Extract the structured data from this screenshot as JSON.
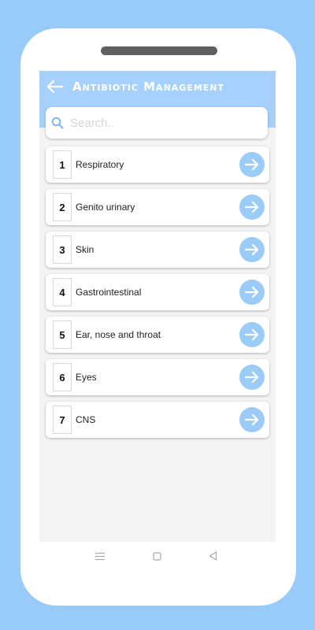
{
  "app": {
    "title": "Antibiotic Management"
  },
  "search": {
    "placeholder": "Search..",
    "value": ""
  },
  "items": [
    {
      "number": "1",
      "label": "Respiratory"
    },
    {
      "number": "2",
      "label": "Genito urinary"
    },
    {
      "number": "3",
      "label": "Skin"
    },
    {
      "number": "4",
      "label": "Gastrointestinal"
    },
    {
      "number": "5",
      "label": "Ear, nose and throat"
    },
    {
      "number": "6",
      "label": "Eyes"
    },
    {
      "number": "7",
      "label": "CNS"
    }
  ],
  "icons": {
    "back": "arrow-left-icon",
    "search": "search-icon",
    "item_action": "arrow-right-icon",
    "nav_recents": "menu-icon",
    "nav_home": "square-icon",
    "nav_back": "triangle-back-icon"
  },
  "colors": {
    "background": "#99cbfa",
    "appbar": "#a6d1fc",
    "accent": "#9bccf8",
    "search_icon": "#7fb6ef"
  }
}
